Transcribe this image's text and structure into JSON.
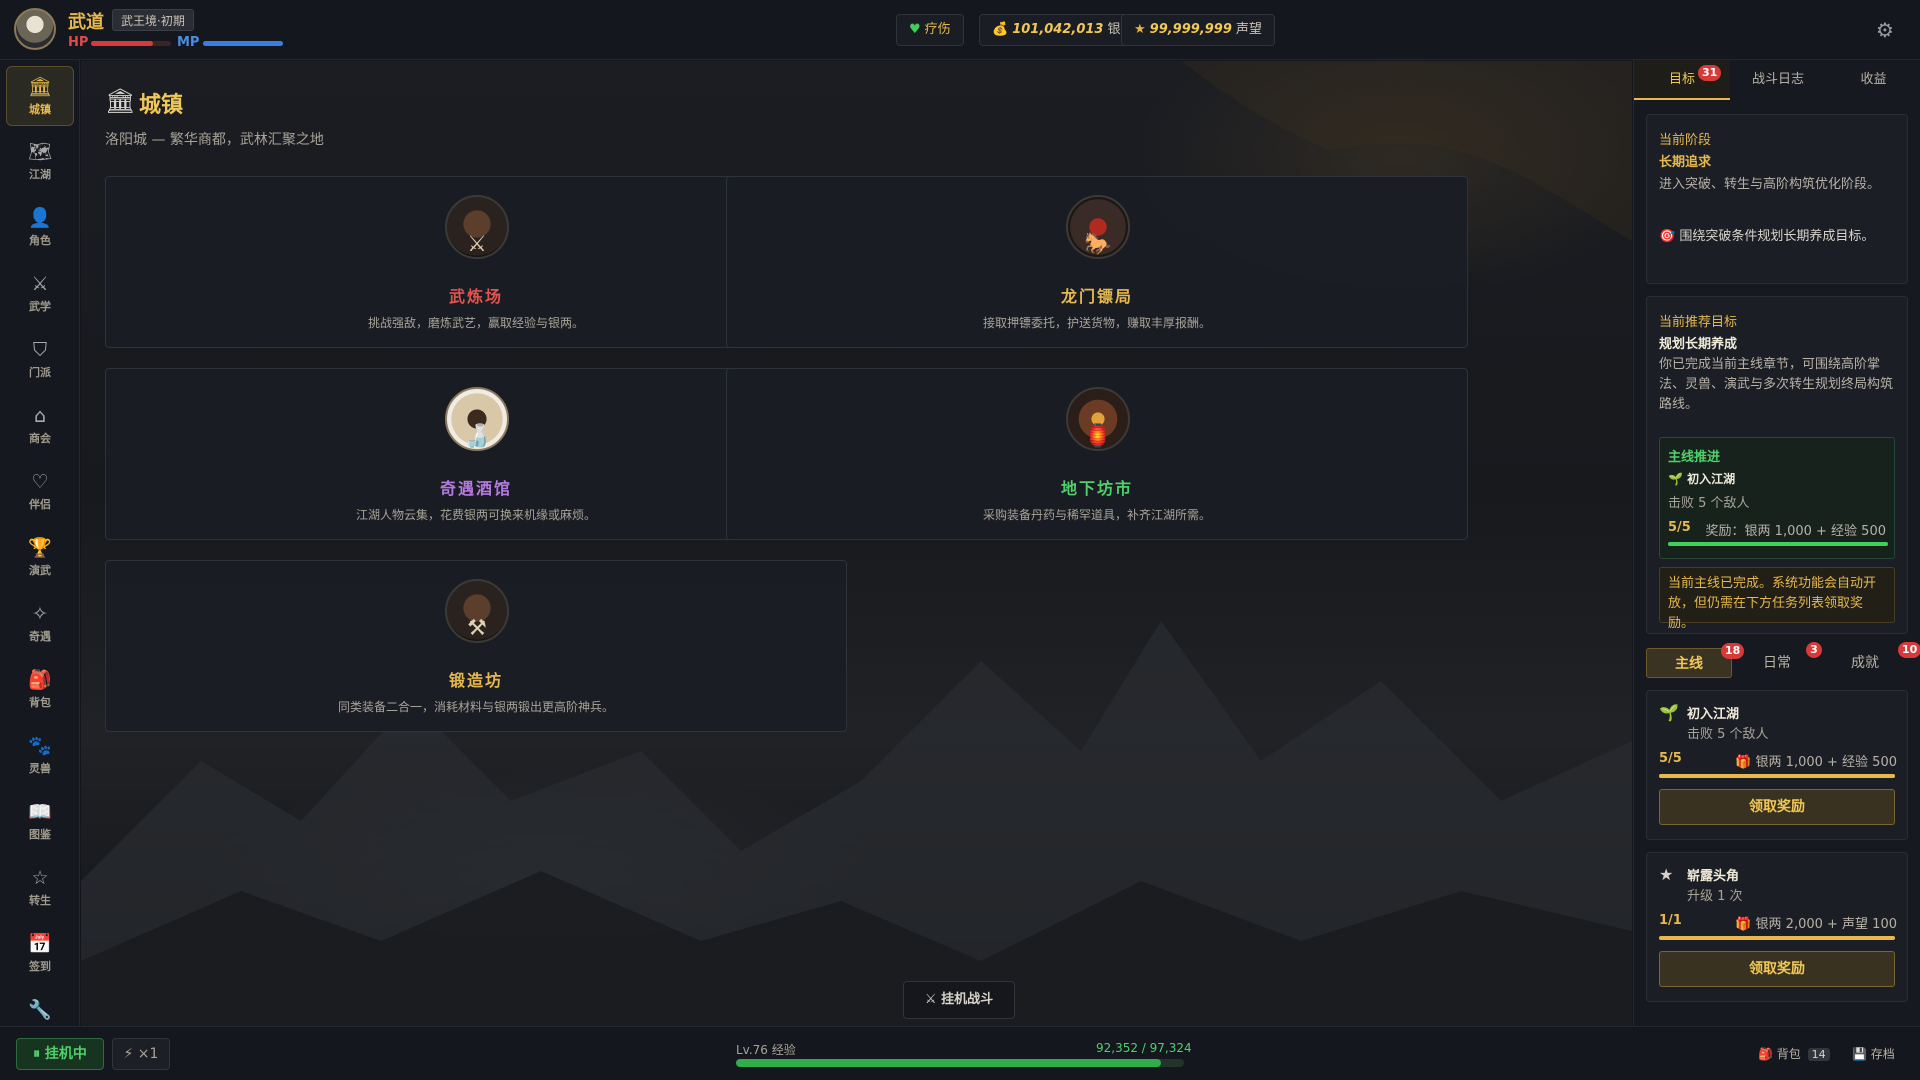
{
  "player": {
    "name": "武道",
    "realm": "武王境·初期",
    "hp_label": "HP",
    "mp_label": "MP",
    "hp_ratio": 0.78,
    "mp_ratio": 1.0
  },
  "topbar": {
    "heal_label": "疗伤",
    "silver_value": "101,042,013",
    "silver_label": "银两",
    "fame_value": "99,999,999",
    "fame_label": "声望",
    "settings_icon": "gear-icon"
  },
  "sidebar": {
    "items": [
      {
        "label": "城镇",
        "icon": "town-icon",
        "glyph": "🏛",
        "active": true
      },
      {
        "label": "江湖",
        "icon": "map-icon",
        "glyph": "🗺",
        "active": false
      },
      {
        "label": "角色",
        "icon": "person-icon",
        "glyph": "👤",
        "active": false
      },
      {
        "label": "武学",
        "icon": "swords-icon",
        "glyph": "⚔",
        "active": false
      },
      {
        "label": "门派",
        "icon": "shield-icon",
        "glyph": "⛉",
        "active": false
      },
      {
        "label": "商会",
        "icon": "shop-icon",
        "glyph": "⌂",
        "active": false
      },
      {
        "label": "伴侣",
        "icon": "heart-icon",
        "glyph": "♡",
        "active": false
      },
      {
        "label": "演武",
        "icon": "trophy-icon",
        "glyph": "🏆",
        "active": false
      },
      {
        "label": "奇遇",
        "icon": "sparkle-icon",
        "glyph": "✧",
        "active": false
      },
      {
        "label": "背包",
        "icon": "backpack-icon",
        "glyph": "🎒",
        "active": false
      },
      {
        "label": "灵兽",
        "icon": "paw-icon",
        "glyph": "🐾",
        "active": false
      },
      {
        "label": "图鉴",
        "icon": "book-icon",
        "glyph": "📖",
        "active": false
      },
      {
        "label": "转生",
        "icon": "star-icon",
        "glyph": "☆",
        "active": false
      },
      {
        "label": "签到",
        "icon": "calendar-icon",
        "glyph": "📅",
        "active": false
      },
      {
        "label": "",
        "icon": "wrench-icon",
        "glyph": "🔧",
        "active": false
      }
    ]
  },
  "main": {
    "title": "城镇",
    "subtitle": "洛阳城 — 繁华商都，武林汇聚之地",
    "cards": [
      {
        "title": "武炼场",
        "desc": "挑战强敌，磨炼武艺，赢取经验与银两。",
        "color": "#e0534f",
        "icon": "training-ground-icon"
      },
      {
        "title": "龙门镖局",
        "desc": "接取押镖委托，护送货物，赚取丰厚报酬。",
        "color": "#e6b84e",
        "icon": "escort-agency-icon"
      },
      {
        "title": "奇遇酒馆",
        "desc": "江湖人物云集，花费银两可换来机缘或麻烦。",
        "color": "#b57ae0",
        "icon": "tavern-icon"
      },
      {
        "title": "地下坊市",
        "desc": "采购装备丹药与稀罕道具，补齐江湖所需。",
        "color": "#4fd06a",
        "icon": "black-market-icon"
      },
      {
        "title": "锻造坊",
        "desc": "同类装备二合一，消耗材料与银两锻出更高阶神兵。",
        "color": "#e6b84e",
        "icon": "forge-icon"
      }
    ],
    "auto_battle_label": "⚔ 挂机战斗"
  },
  "right_panel": {
    "tabs": [
      {
        "label": "目标",
        "badge": "31",
        "active": true
      },
      {
        "label": "战斗日志",
        "badge": "",
        "active": false
      },
      {
        "label": "收益",
        "badge": "",
        "active": false
      }
    ],
    "stage": {
      "label": "当前阶段",
      "name": "长期追求",
      "desc": "进入突破、转生与高阶构筑优化阶段。",
      "tip": "🎯 围绕突破条件规划长期养成目标。"
    },
    "recommend": {
      "label": "当前推荐目标",
      "name": "规划长期养成",
      "desc": "你已完成当前主线章节，可围绕高阶掌法、灵兽、演武与多次转生规划终局构筑路线。",
      "main_quest": {
        "label": "主线推进",
        "title": "初入江湖",
        "sub": "击败 5 个敌人",
        "progress": "5/5",
        "progress_ratio": 1.0,
        "reward": "奖励：银两 1,000 + 经验 500"
      },
      "notice": "当前主线已完成。系统功能会自动开放，但仍需在下方任务列表领取奖励。"
    },
    "quest_tabs": [
      {
        "label": "主线",
        "badge": "18",
        "active": true
      },
      {
        "label": "日常",
        "badge": "3",
        "active": false
      },
      {
        "label": "成就",
        "badge": "10",
        "active": false
      }
    ],
    "quests": [
      {
        "icon": "sprout-icon",
        "glyph": "🌱",
        "title": "初入江湖",
        "sub": "击败 5 个敌人",
        "progress": "5/5",
        "progress_ratio": 1.0,
        "reward": "银两 1,000 + 经验 500",
        "button": "领取奖励"
      },
      {
        "icon": "star-icon",
        "glyph": "★",
        "title": "崭露头角",
        "sub": "升级 1 次",
        "progress": "1/1",
        "progress_ratio": 1.0,
        "reward": "银两 2,000 + 声望 100",
        "button": "领取奖励"
      }
    ]
  },
  "bottombar": {
    "idle_label": "⏸ 挂机中",
    "speed_label": "⚡ ×1",
    "exp_label": "Lv.76 经验",
    "exp_value": "92,352 / 97,324",
    "exp_ratio": 0.949,
    "bag_label": "背包",
    "bag_count": "14",
    "save_label": "存档"
  }
}
